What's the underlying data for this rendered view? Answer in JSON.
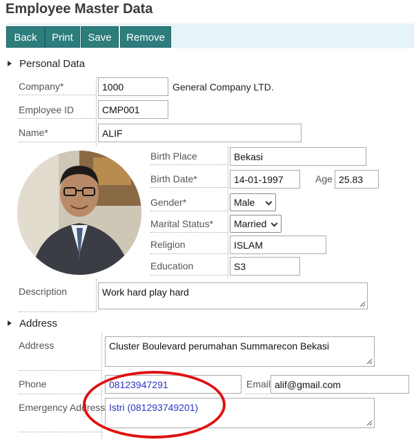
{
  "header": {
    "title": "Employee Master Data"
  },
  "toolbar": {
    "back": "Back",
    "print": "Print",
    "save": "Save",
    "remove": "Remove"
  },
  "sections": {
    "personal": "Personal Data",
    "address": "Address"
  },
  "personal": {
    "company_label": "Company*",
    "company_value": "1000",
    "company_name": "General Company LTD.",
    "employee_id_label": "Employee ID",
    "employee_id_value": "CMP001",
    "name_label": "Name*",
    "name_value": "ALIF",
    "birth_place_label": "Birth Place",
    "birth_place_value": "Bekasi",
    "birth_date_label": "Birth Date*",
    "birth_date_value": "14-01-1997",
    "age_label": "Age",
    "age_value": "25.83",
    "gender_label": "Gender*",
    "gender_value": "Male",
    "marital_label": "Marital Status*",
    "marital_value": "Married",
    "religion_label": "Religion",
    "religion_value": "ISLAM",
    "education_label": "Education",
    "education_value": "S3",
    "description_label": "Description",
    "description_value": "Work hard play hard"
  },
  "address": {
    "address_label": "Address",
    "address_value": "Cluster Boulevard perumahan Summarecon Bekasi",
    "phone_label": "Phone",
    "phone_value": "08123947291",
    "email_label": "Email",
    "email_value": "alif@gmail.com",
    "emergency_label": "Emergency Address",
    "emergency_value": "Istri (081293749201)"
  },
  "colors": {
    "toolbar_button": "#2e7d7d",
    "toolbar_bg": "#e6f4f7",
    "annotation_circle": "#e01010",
    "link_text": "#2b35c4"
  },
  "icons": {
    "section_expand": "caret-right-icon",
    "dropdown": "chevron-down-icon",
    "resize": "resize-grip-icon"
  }
}
